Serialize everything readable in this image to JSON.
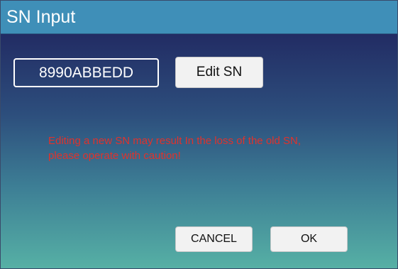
{
  "dialog": {
    "title": "SN Input"
  },
  "sn": {
    "value": "8990ABBEDD",
    "edit_label": "Edit SN"
  },
  "warning": {
    "line1": "Editing a new SN  may result In  the loss of  the old SN,",
    "line2": "please operate with caution!"
  },
  "actions": {
    "cancel_label": "CANCEL",
    "ok_label": "OK"
  },
  "colors": {
    "title_bar": "#3f8fb8",
    "warning_text": "#e0322c",
    "gradient_top": "#222c64",
    "gradient_bottom": "#56b0a5"
  }
}
